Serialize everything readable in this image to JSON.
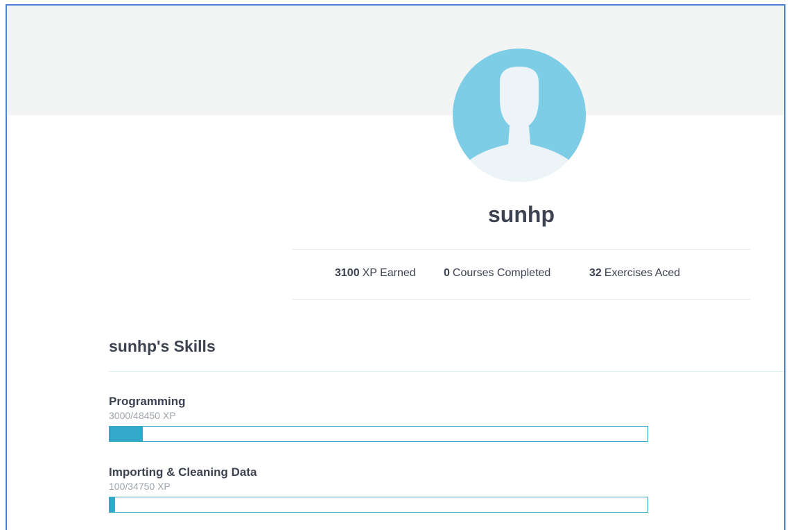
{
  "profile": {
    "username": "sunhp",
    "avatar_icon": "user-silhouette-icon"
  },
  "stats": {
    "xp_value": "3100",
    "xp_label": "XP Earned",
    "courses_value": "0",
    "courses_label": "Courses Completed",
    "exercises_value": "32",
    "exercises_label": "Exercises Aced"
  },
  "skills": {
    "title": "sunhp's Skills",
    "items": [
      {
        "name": "Programming",
        "xp_text": "3000/48450 XP",
        "earned": 3000,
        "total": 48450
      },
      {
        "name": "Importing & Cleaning Data",
        "xp_text": "100/34750 XP",
        "earned": 100,
        "total": 34750
      }
    ]
  },
  "colors": {
    "accent": "#33aacc",
    "avatar_bg": "#7ecde6",
    "text": "#3d4251",
    "muted": "#9ea4ac"
  }
}
